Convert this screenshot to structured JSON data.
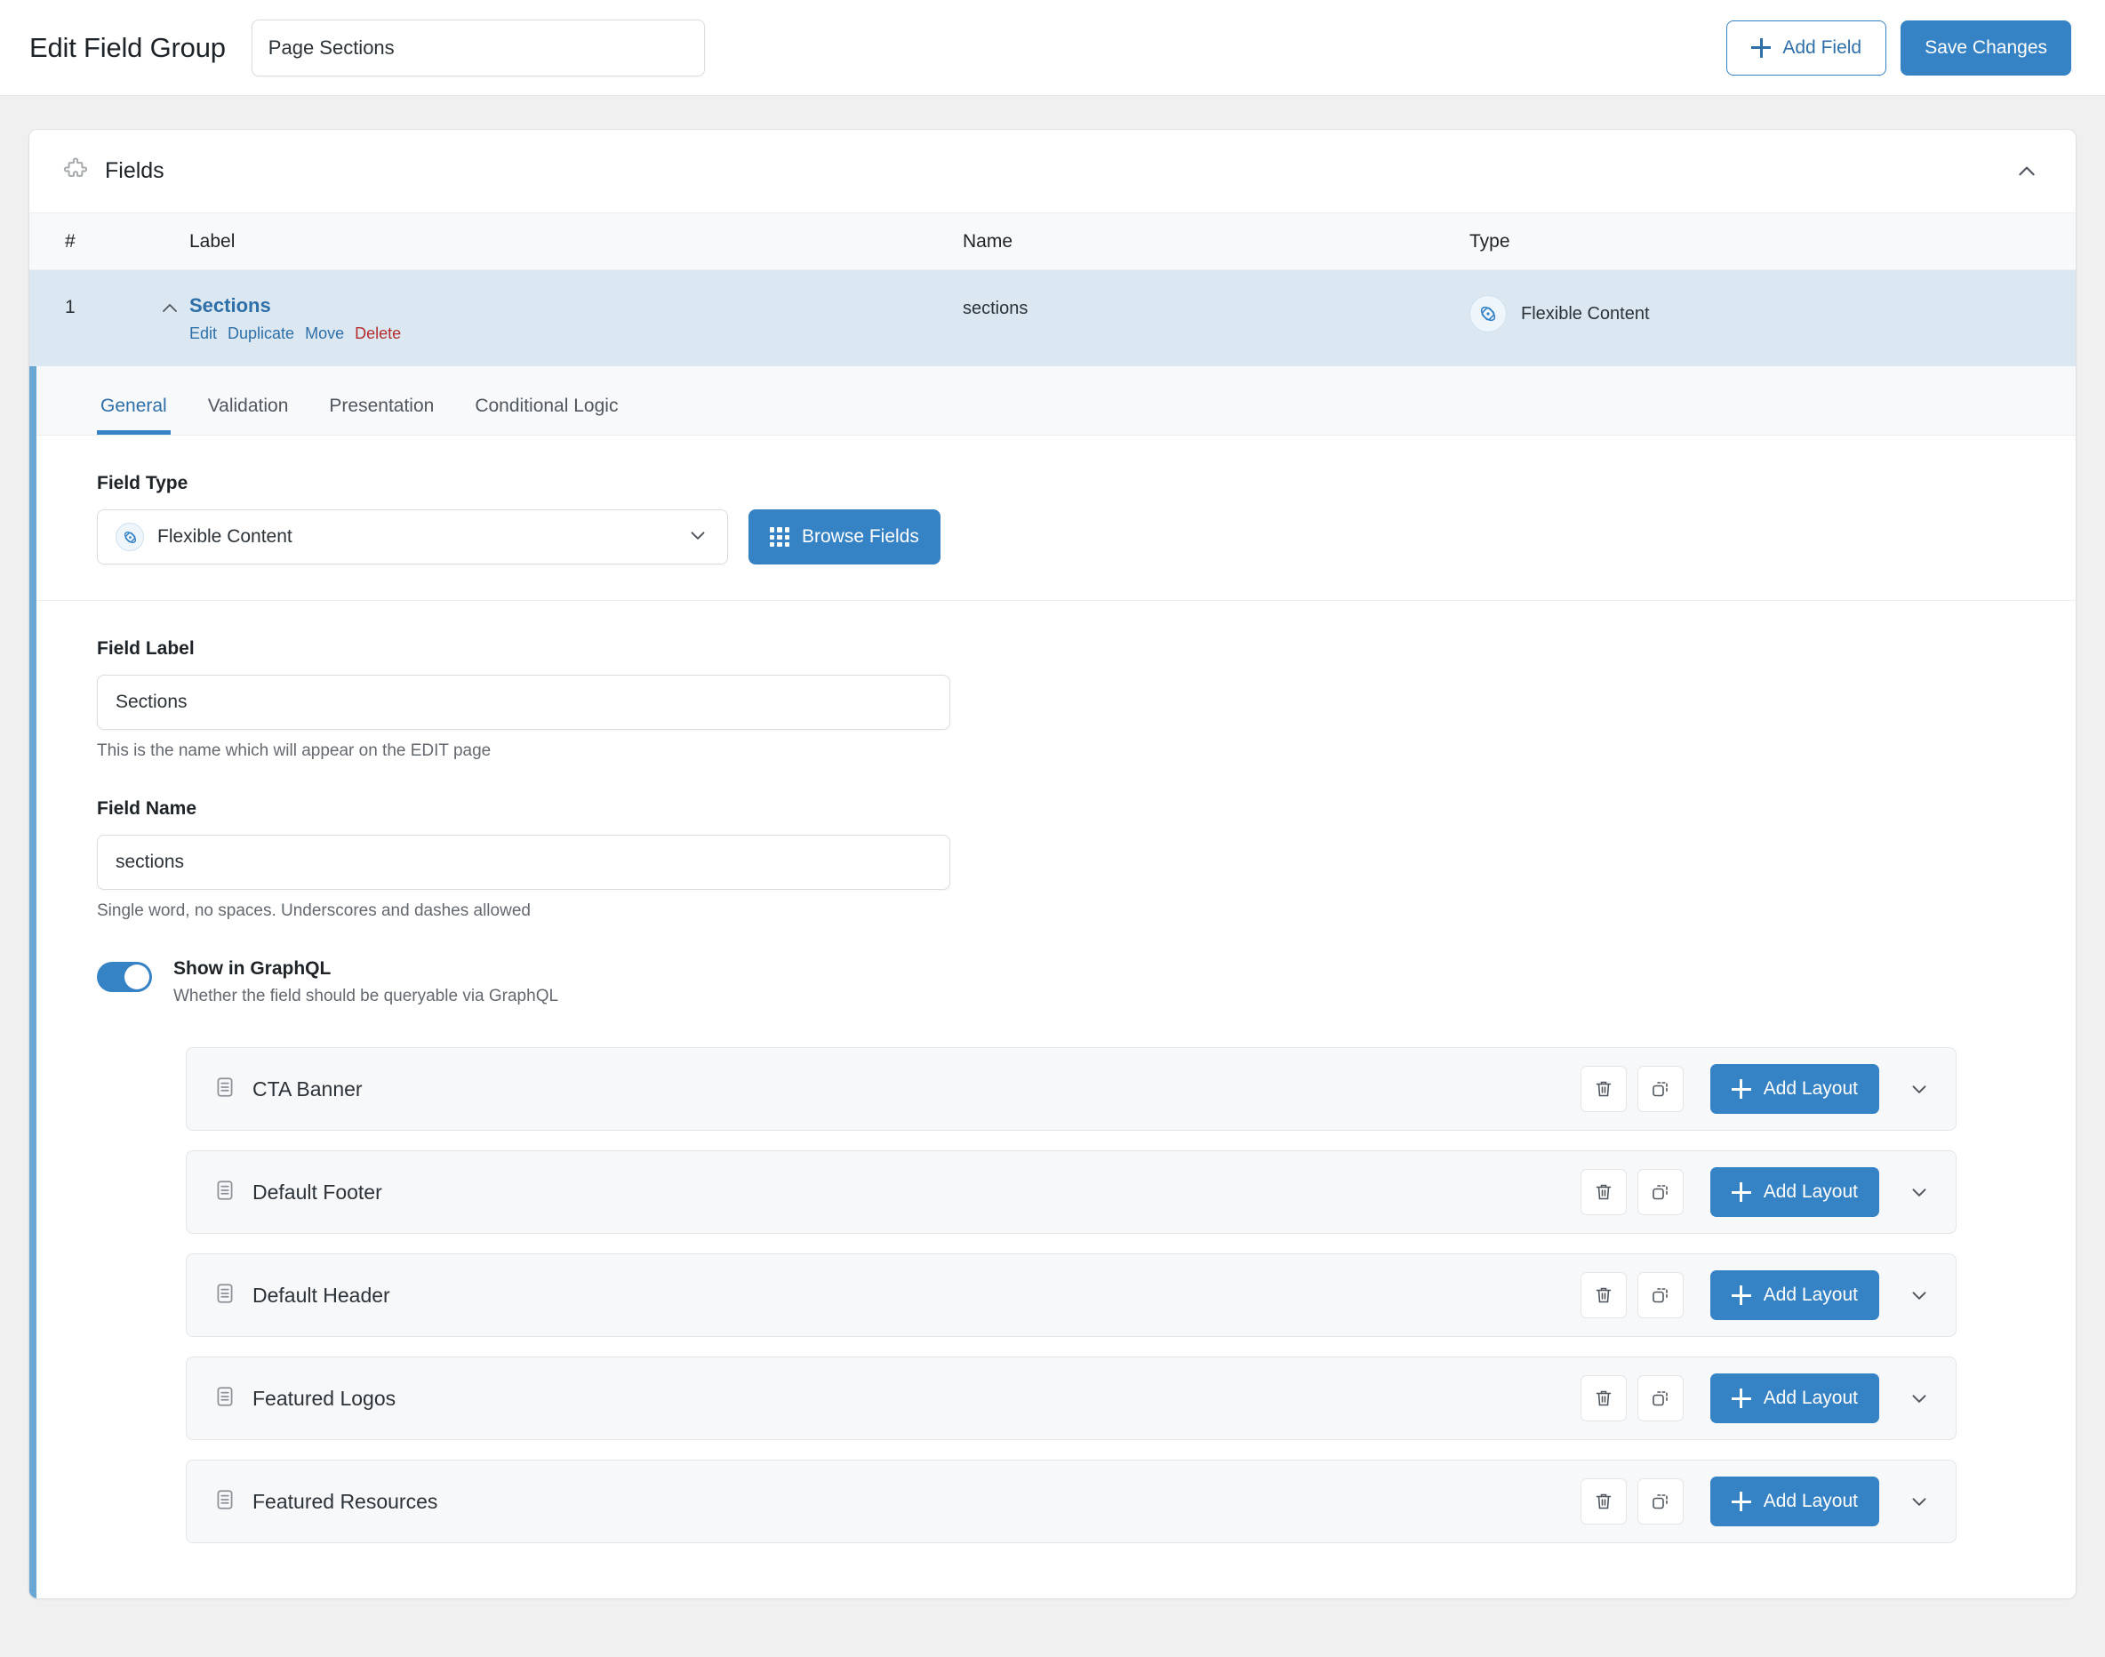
{
  "header": {
    "page_heading": "Edit Field Group",
    "title_value": "Page Sections",
    "title_placeholder": "Add title",
    "add_field_label": "Add Field",
    "save_label": "Save Changes"
  },
  "fields_card": {
    "title": "Fields",
    "collapse_icon": "chevron-up-icon",
    "columns": {
      "num": "#",
      "label": "Label",
      "name": "Name",
      "type": "Type"
    },
    "rows": [
      {
        "num": "1",
        "label": "Sections",
        "name": "sections",
        "type": "Flexible Content",
        "actions": [
          {
            "label": "Edit",
            "style": "link"
          },
          {
            "label": "Duplicate",
            "style": "link"
          },
          {
            "label": "Move",
            "style": "link"
          },
          {
            "label": "Delete",
            "style": "danger"
          }
        ]
      }
    ]
  },
  "field_panel": {
    "tabs": [
      {
        "label": "General",
        "active": true
      },
      {
        "label": "Validation",
        "active": false
      },
      {
        "label": "Presentation",
        "active": false
      },
      {
        "label": "Conditional Logic",
        "active": false
      }
    ],
    "field_type": {
      "label": "Field Type",
      "value": "Flexible Content",
      "icon": "flexible-content-icon",
      "browse_label": "Browse Fields"
    },
    "field_label": {
      "label": "Field Label",
      "value": "Sections",
      "help": "This is the name which will appear on the EDIT page"
    },
    "field_name": {
      "label": "Field Name",
      "value": "sections",
      "help": "Single word, no spaces. Underscores and dashes allowed"
    },
    "graphql": {
      "title": "Show in GraphQL",
      "description": "Whether the field should be queryable via GraphQL",
      "enabled": true
    },
    "add_layout_label": "Add Layout",
    "layouts": [
      {
        "name": "CTA Banner"
      },
      {
        "name": "Default Footer"
      },
      {
        "name": "Default Header"
      },
      {
        "name": "Featured Logos"
      },
      {
        "name": "Featured Resources"
      }
    ]
  },
  "colors": {
    "accent_blue": "#3582c4",
    "accent_bar": "#6ba7d4",
    "selected_row": "#dbe8f1",
    "danger_red": "#b32d2e",
    "page_bg": "#f0f0f1"
  }
}
